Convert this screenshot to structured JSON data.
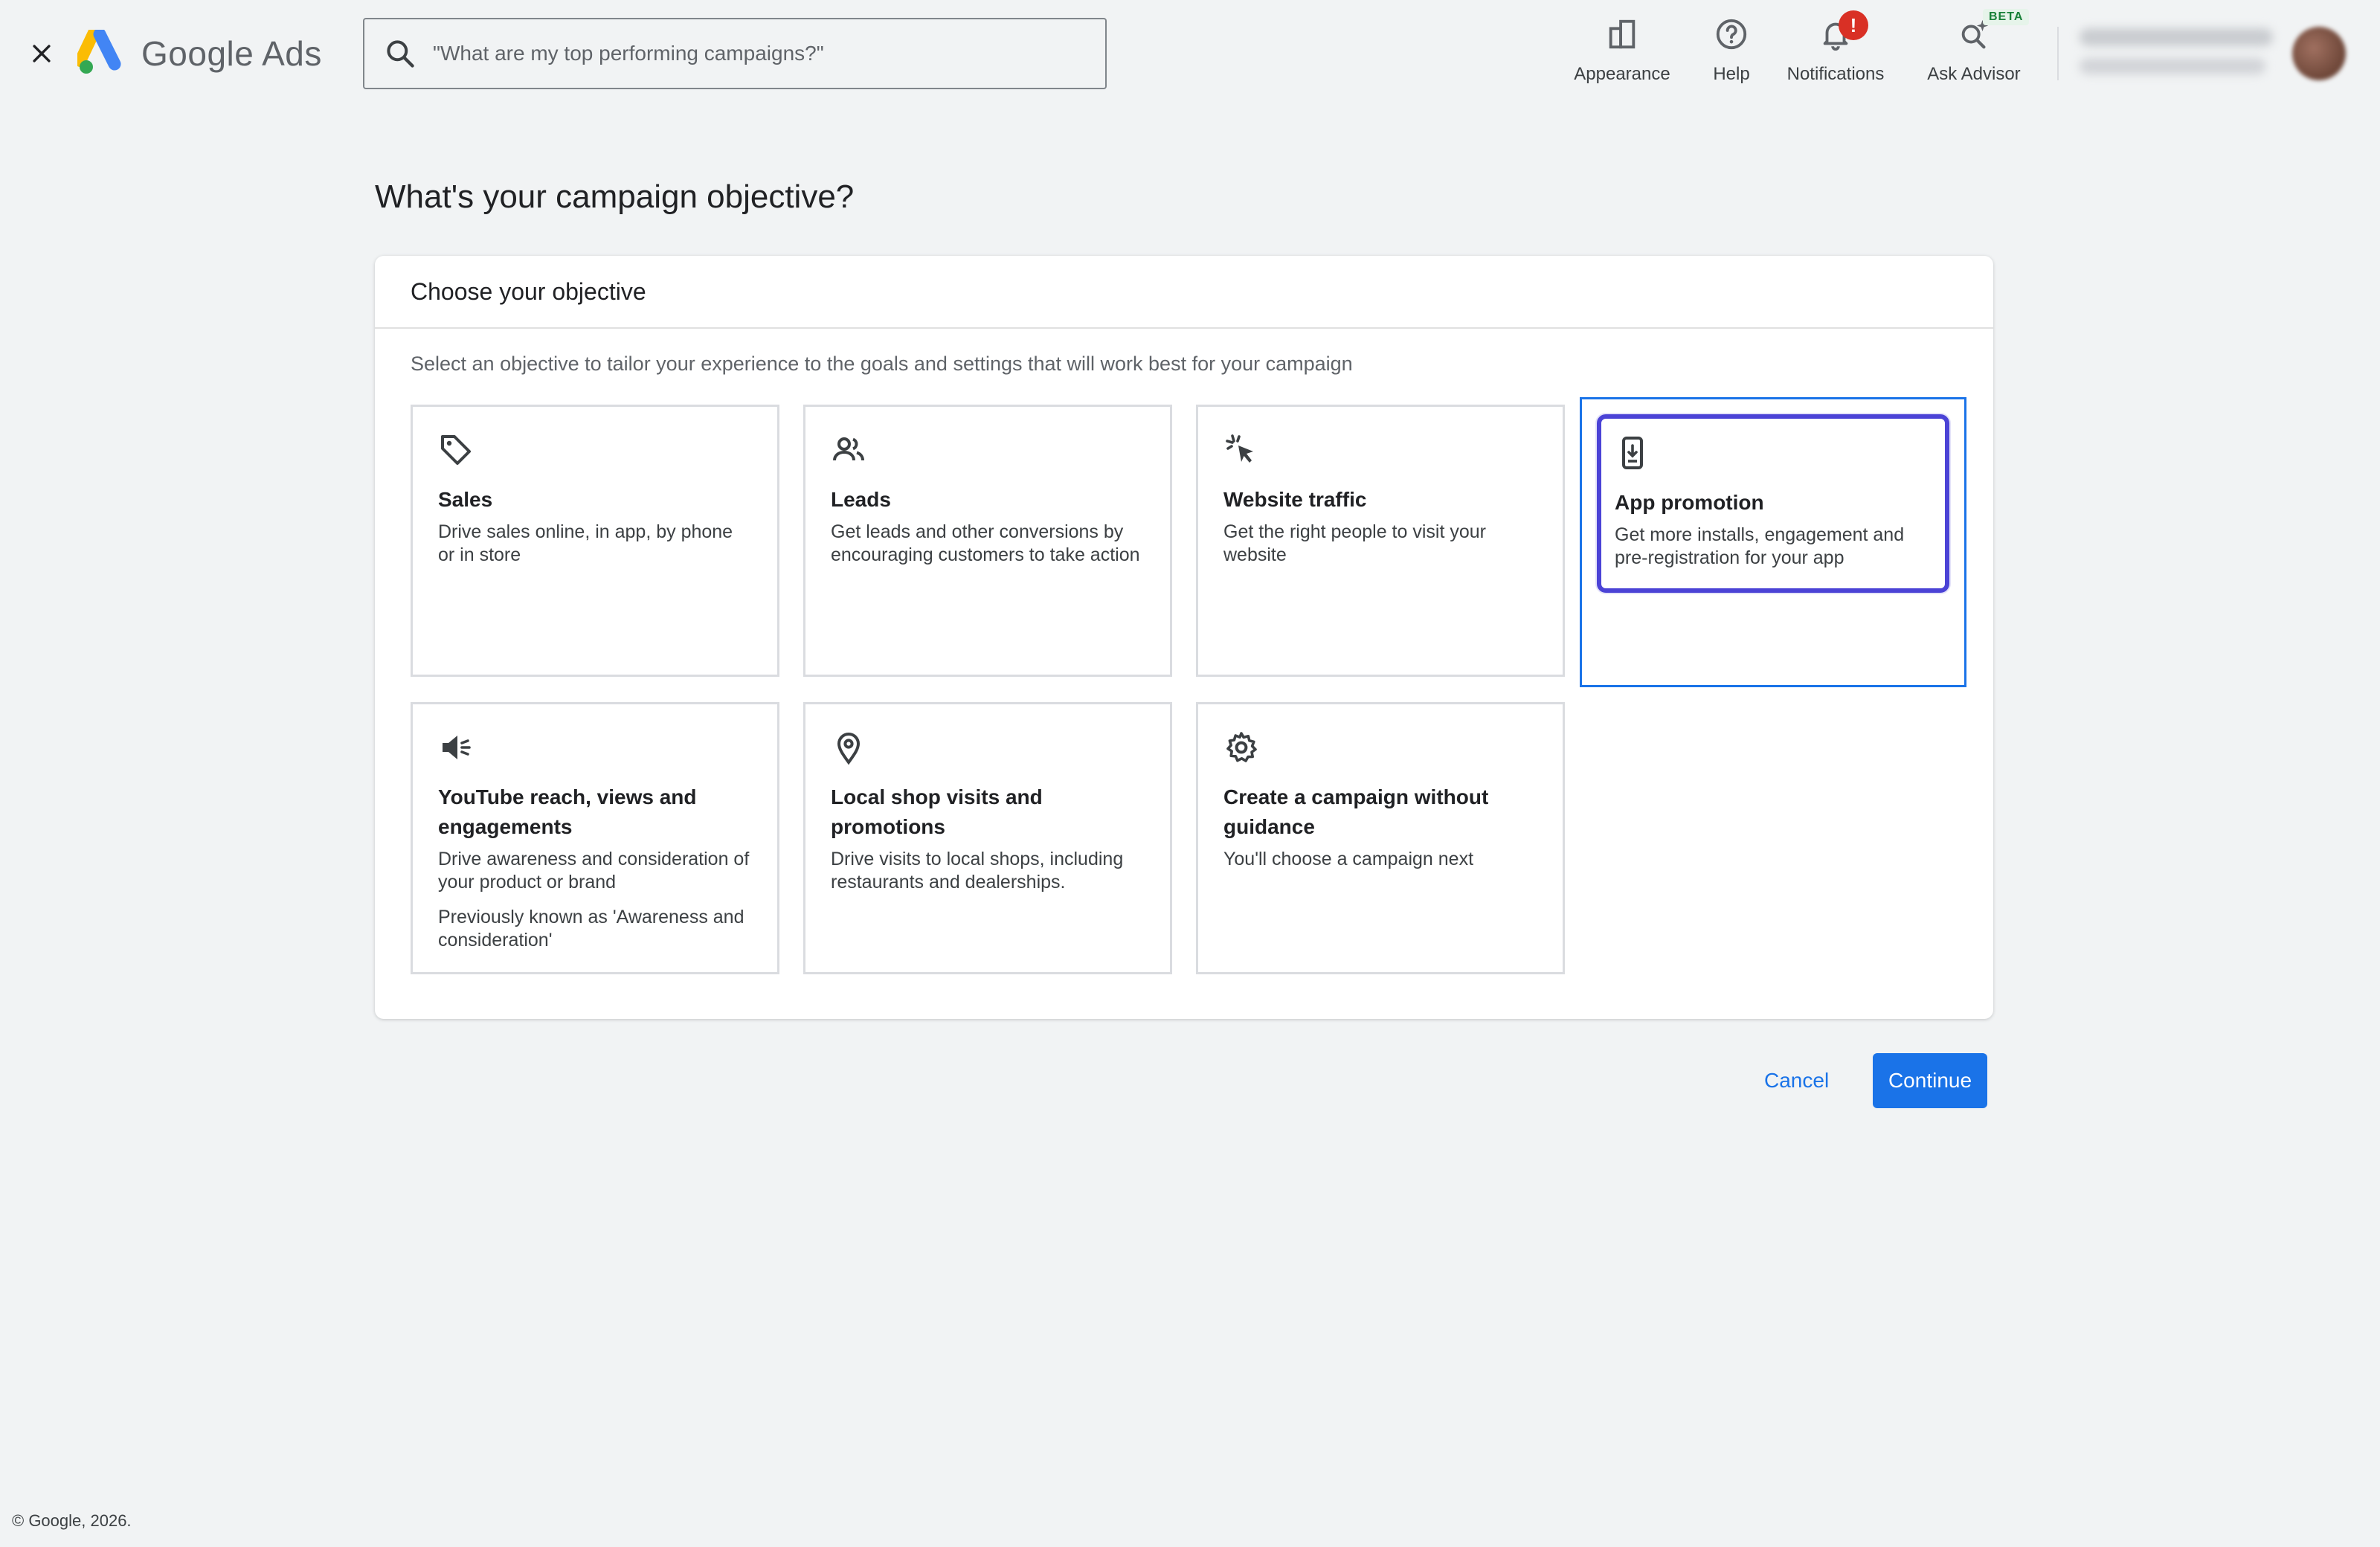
{
  "header": {
    "brand": "Google Ads",
    "search_placeholder": "\"What are my top performing campaigns?\"",
    "tools": [
      {
        "label": "Appearance",
        "icon": "appearance-icon"
      },
      {
        "label": "Help",
        "icon": "help-icon"
      },
      {
        "label": "Notifications",
        "icon": "bell-icon",
        "badge": "!"
      },
      {
        "label": "Ask Advisor",
        "icon": "sparkle-search-icon",
        "tag": "BETA"
      }
    ]
  },
  "main": {
    "title": "What's your campaign objective?",
    "panel_title": "Choose your objective",
    "panel_desc": "Select an objective to tailor your experience to the goals and settings that will work best for your campaign",
    "objectives": [
      {
        "title": "Sales",
        "desc": "Drive sales online, in app, by phone or in store",
        "icon": "tag-icon"
      },
      {
        "title": "Leads",
        "desc": "Get leads and other conversions by encouraging customers to take action",
        "icon": "people-icon"
      },
      {
        "title": "Website traffic",
        "desc": "Get the right people to visit your website",
        "icon": "cursor-click-icon"
      },
      {
        "title": "App promotion",
        "desc": "Get more installs, engagement and pre-registration for your app",
        "icon": "phone-download-icon",
        "selected": true
      },
      {
        "title": "YouTube reach, views and engagements",
        "desc": "Drive awareness and consideration of your product or brand",
        "note": "Previously known as 'Awareness and consideration'",
        "icon": "megaphone-icon"
      },
      {
        "title": "Local shop visits and promotions",
        "desc": "Drive visits to local shops, including restaurants and dealerships.",
        "icon": "location-pin-icon"
      },
      {
        "title": "Create a campaign without guidance",
        "desc": "You'll choose a campaign next",
        "icon": "gear-icon"
      }
    ],
    "cancel_label": "Cancel",
    "continue_label": "Continue"
  },
  "footer": {
    "copyright": "© Google, 2026."
  },
  "colors": {
    "accent": "#1a73e8",
    "selected_outline": "#4b43d6",
    "badge": "#d93025",
    "background": "#f1f3f4"
  }
}
